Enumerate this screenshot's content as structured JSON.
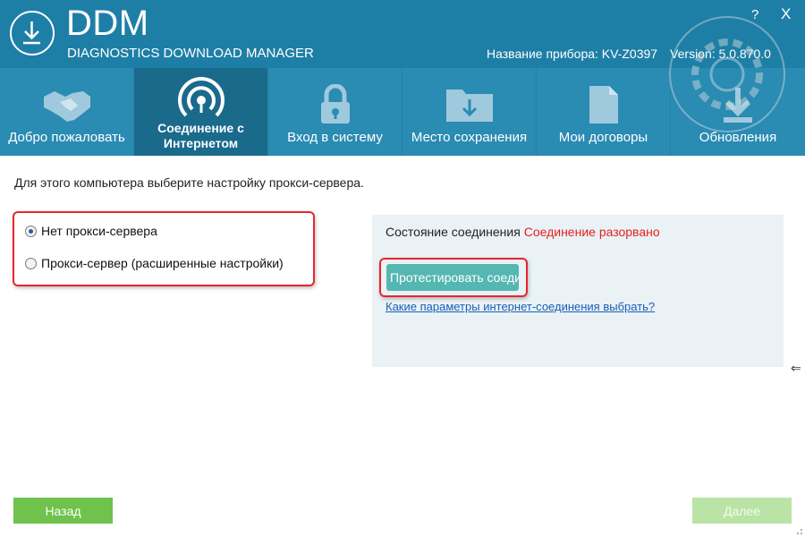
{
  "header": {
    "title": "DDM",
    "subtitle": "DIAGNOSTICS DOWNLOAD MANAGER",
    "device_label": "Название прибора: KV-Z0397",
    "version_label": "Version:  5.0.870.0",
    "help": "?",
    "close": "X",
    "logo_icon": "download-icon"
  },
  "tabs": [
    {
      "label": "Добро пожаловать",
      "icon": "handshake-icon",
      "active": false
    },
    {
      "label": "Соединение с Интернетом",
      "icon": "wifi-signal-icon",
      "active": true
    },
    {
      "label": "Вход в систему",
      "icon": "lock-icon",
      "active": false
    },
    {
      "label": "Место сохранения",
      "icon": "folder-download-icon",
      "active": false
    },
    {
      "label": "Мои договоры",
      "icon": "document-icon",
      "active": false
    },
    {
      "label": "Обновления",
      "icon": "update-download-icon",
      "active": false
    }
  ],
  "main": {
    "instruction": "Для этого компьютера выберите настройку прокси-сервера.",
    "proxy_options": [
      {
        "label": "Нет прокси-сервера",
        "selected": true
      },
      {
        "label": "Прокси-сервер (расширенные настройки)",
        "selected": false
      }
    ],
    "status_label": "Состояние соединения",
    "status_value": "Соединение разорвано",
    "test_button": "Протестировать соединение",
    "help_link": "Какие параметры интернет-соединения выбрать?"
  },
  "footer": {
    "back": "Назад",
    "next": "Далее"
  },
  "colors": {
    "header": "#1e7fa6",
    "tab_active": "#1a6a8c",
    "status_error": "#e81f1f",
    "highlight_border": "#e8252b",
    "button_green": "#6fc24b",
    "button_test": "#55b7b2"
  }
}
